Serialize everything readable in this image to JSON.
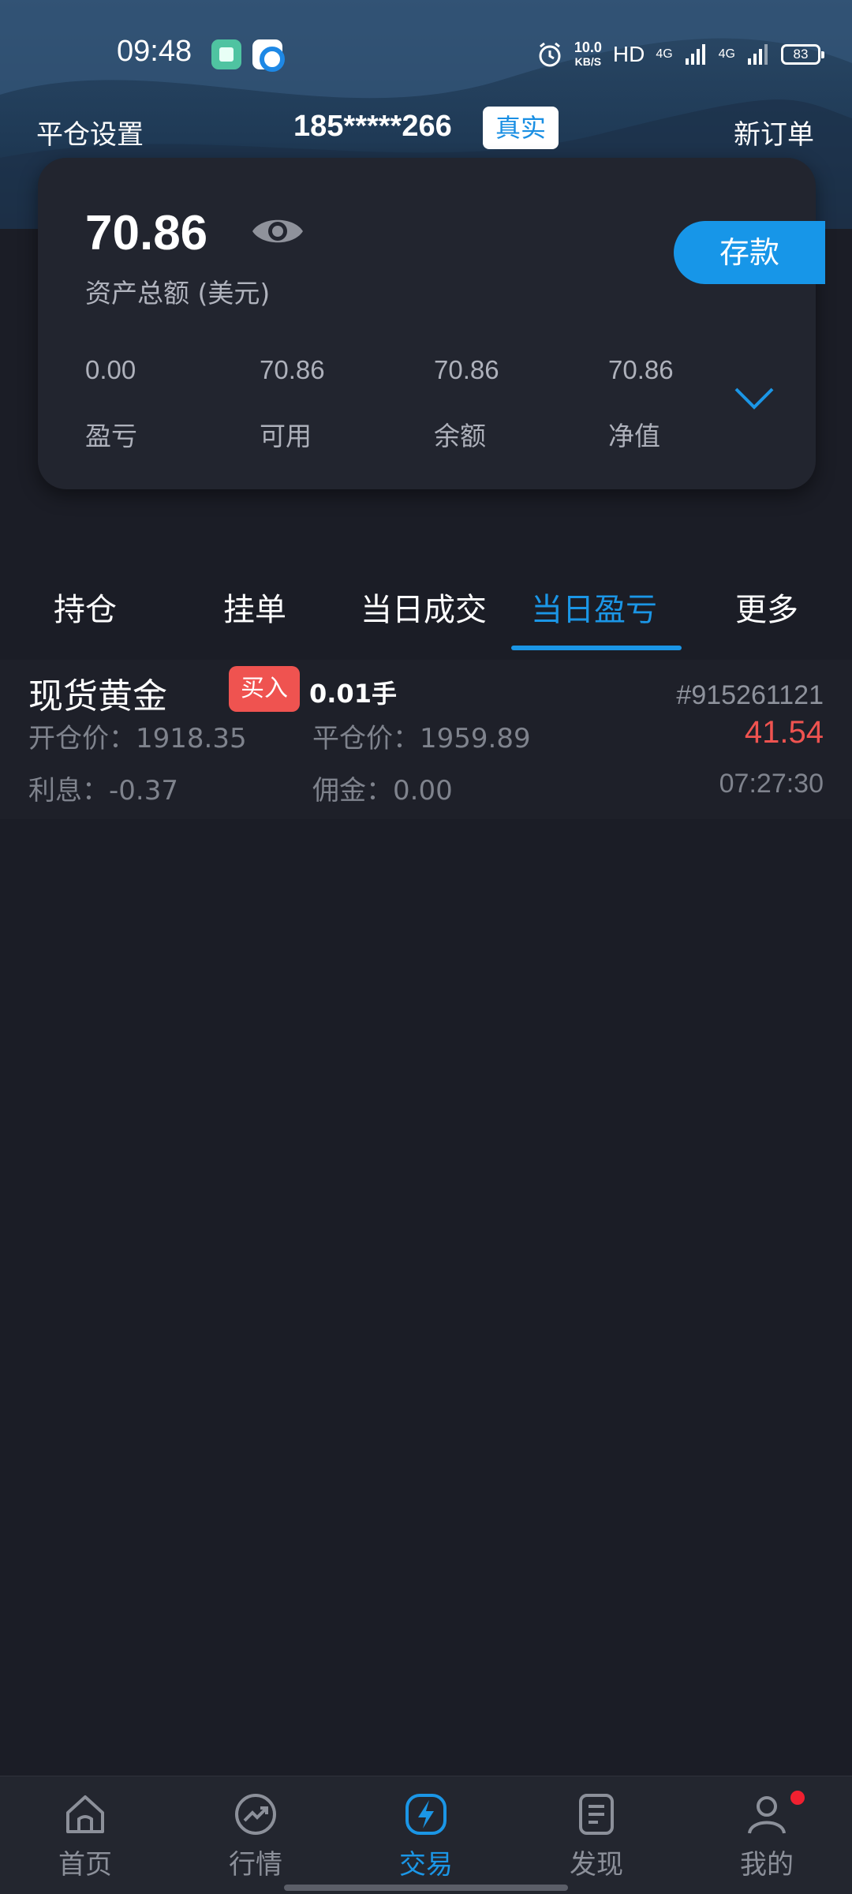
{
  "status_bar": {
    "time": "09:48",
    "net_speed_value": "10.0",
    "net_speed_unit": "KB/S",
    "hd": "HD",
    "net_type_1": "4G",
    "net_type_2": "4G",
    "battery": "83"
  },
  "header": {
    "left_label": "平仓设置",
    "account": "185*****266",
    "account_type": "真实",
    "right_label": "新订单"
  },
  "asset": {
    "total": "70.86",
    "total_label": "资产总额 (美元)",
    "deposit_label": "存款",
    "stats": [
      {
        "value": "0.00",
        "label": "盈亏"
      },
      {
        "value": "70.86",
        "label": "可用"
      },
      {
        "value": "70.86",
        "label": "余额"
      },
      {
        "value": "70.86",
        "label": "净值"
      }
    ]
  },
  "tabs": [
    {
      "label": "持仓"
    },
    {
      "label": "挂单"
    },
    {
      "label": "当日成交"
    },
    {
      "label": "当日盈亏"
    },
    {
      "label": "更多"
    }
  ],
  "active_tab": "当日盈亏",
  "order": {
    "symbol": "现货黄金",
    "side": "买入",
    "lots": "0.01手",
    "ticket": "#915261121",
    "open_price": "开仓价：1918.35",
    "close_price": "平仓价：1959.89",
    "profit": "41.54",
    "interest": "利息：-0.37",
    "commission": "佣金：0.00",
    "time": "07:27:30"
  },
  "bottom_nav": [
    {
      "label": "首页",
      "icon": "home-icon"
    },
    {
      "label": "行情",
      "icon": "market-trend-icon"
    },
    {
      "label": "交易",
      "icon": "lightning-icon"
    },
    {
      "label": "发现",
      "icon": "document-icon"
    },
    {
      "label": "我的",
      "icon": "user-icon"
    }
  ],
  "colors": {
    "accent": "#1b96e6",
    "loss_profit_red": "#ef5350",
    "background": "#1b1d26"
  }
}
